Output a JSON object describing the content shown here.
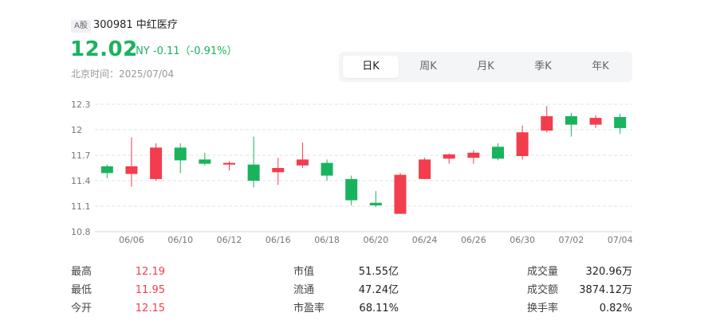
{
  "stock": {
    "market_badge": "A股",
    "code_name": "300981 中红医疗",
    "price": "12.02",
    "change": "CNY -0.11（-0.91%）",
    "time": "北京时间：2025/07/04"
  },
  "tabs": [
    "日K",
    "周K",
    "月K",
    "季K",
    "年K"
  ],
  "active_tab": "日K",
  "colors": {
    "up": "#f23d4f",
    "down": "#19b35e"
  },
  "chart_data": {
    "type": "candlestick",
    "y_ticks": [
      "12.3",
      "12",
      "11.7",
      "11.4",
      "11.1",
      "10.8"
    ],
    "ylim": [
      10.8,
      12.3
    ],
    "x_ticks": [
      "06/06",
      "06/10",
      "06/12",
      "06/16",
      "06/18",
      "06/20",
      "06/24",
      "06/26",
      "06/30",
      "07/02",
      "07/04"
    ],
    "candles": [
      {
        "open": 11.57,
        "close": 11.49,
        "high": 11.59,
        "low": 11.43
      },
      {
        "open": 11.48,
        "close": 11.57,
        "high": 11.91,
        "low": 11.33
      },
      {
        "open": 11.42,
        "close": 11.79,
        "high": 11.84,
        "low": 11.4
      },
      {
        "open": 11.79,
        "close": 11.64,
        "high": 11.84,
        "low": 11.49
      },
      {
        "open": 11.65,
        "close": 11.6,
        "high": 11.73,
        "low": 11.58
      },
      {
        "open": 11.59,
        "close": 11.61,
        "high": 11.63,
        "low": 11.52
      },
      {
        "open": 11.59,
        "close": 11.4,
        "high": 11.92,
        "low": 11.32
      },
      {
        "open": 11.5,
        "close": 11.55,
        "high": 11.67,
        "low": 11.35
      },
      {
        "open": 11.58,
        "close": 11.65,
        "high": 11.85,
        "low": 11.55
      },
      {
        "open": 11.61,
        "close": 11.46,
        "high": 11.65,
        "low": 11.4
      },
      {
        "open": 11.42,
        "close": 11.17,
        "high": 11.46,
        "low": 11.11
      },
      {
        "open": 11.14,
        "close": 11.11,
        "high": 11.28,
        "low": 11.09
      },
      {
        "open": 11.01,
        "close": 11.47,
        "high": 11.49,
        "low": 11.01
      },
      {
        "open": 11.42,
        "close": 11.65,
        "high": 11.67,
        "low": 11.42
      },
      {
        "open": 11.66,
        "close": 11.71,
        "high": 11.72,
        "low": 11.6
      },
      {
        "open": 11.67,
        "close": 11.73,
        "high": 11.76,
        "low": 11.6
      },
      {
        "open": 11.8,
        "close": 11.66,
        "high": 11.84,
        "low": 11.64
      },
      {
        "open": 11.69,
        "close": 11.97,
        "high": 12.05,
        "low": 11.65
      },
      {
        "open": 11.99,
        "close": 12.16,
        "high": 12.28,
        "low": 11.97
      },
      {
        "open": 12.16,
        "close": 12.06,
        "high": 12.2,
        "low": 11.92
      },
      {
        "open": 12.06,
        "close": 12.14,
        "high": 12.17,
        "low": 12.02
      },
      {
        "open": 12.15,
        "close": 12.02,
        "high": 12.19,
        "low": 11.95
      }
    ]
  },
  "stats": {
    "col1": [
      {
        "label": "最高",
        "value": "12.19"
      },
      {
        "label": "最低",
        "value": "11.95"
      },
      {
        "label": "今开",
        "value": "12.15"
      }
    ],
    "col2": [
      {
        "label": "市值",
        "value": "51.55亿"
      },
      {
        "label": "流通",
        "value": "47.24亿"
      },
      {
        "label": "市盈率",
        "value": "68.11%"
      }
    ],
    "col3": [
      {
        "label": "成交量",
        "value": "320.96万"
      },
      {
        "label": "成交额",
        "value": "3874.12万"
      },
      {
        "label": "换手率",
        "value": "0.82%"
      }
    ]
  }
}
